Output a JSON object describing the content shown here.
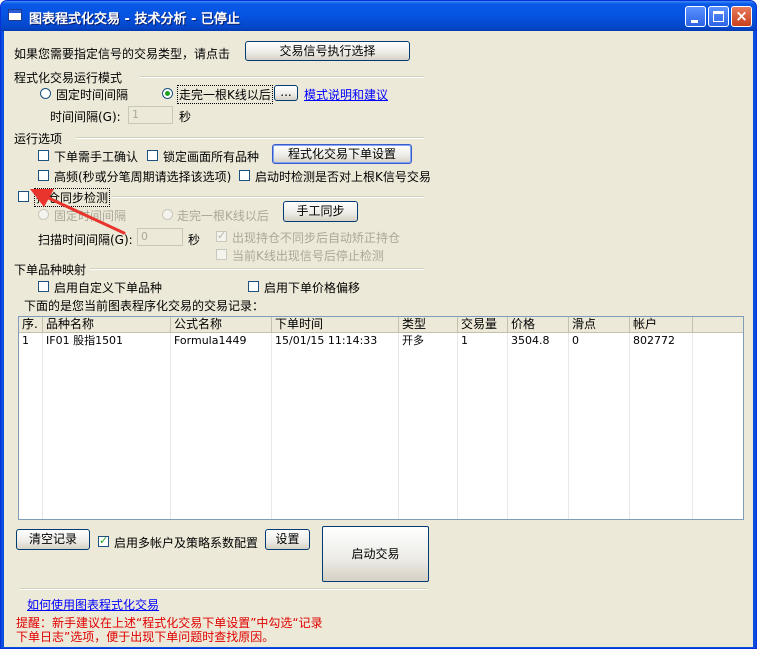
{
  "window": {
    "title": "图表程式化交易 - 技术分析 - 已停止"
  },
  "signal_type": {
    "prompt": "如果您需要指定信号的交易类型，请点击",
    "button": "交易信号执行选择"
  },
  "run_mode": {
    "section": "程式化交易运行模式",
    "option_fixed": "固定时间间隔",
    "option_bar": "走完一根K线以后",
    "more_button": "...",
    "help_link": "模式说明和建议",
    "interval_label": "时间间隔(G):",
    "interval_value": "1",
    "interval_unit": "秒"
  },
  "run_options": {
    "section": "运行选项",
    "manual_confirm": "下单需手工确认",
    "lock_all": "锁定画面所有品种",
    "order_settings_button": "程式化交易下单设置",
    "high_freq": "高频(秒或分笔周期请选择该选项)",
    "startup_check": "启动时检测是否对上根K信号交易"
  },
  "position_sync": {
    "label": "持仓同步检测",
    "option_fixed": "固定时间间隔",
    "option_bar": "走完一根K线以后",
    "manual_sync_button": "手工同步",
    "scan_label": "扫描时间间隔(G):",
    "scan_value": "0",
    "scan_unit": "秒",
    "auto_correct": "出现持仓不同步后自动矫正持仓",
    "stop_detect": "当前K线出现信号后停止检测"
  },
  "order_mapping": {
    "section": "下单品种映射",
    "custom_symbol": "启用自定义下单品种",
    "price_offset": "启用下单价格偏移"
  },
  "records": {
    "caption": "下面的是您当前图表程序化交易的交易记录：",
    "columns": [
      "序.",
      "品种名称",
      "公式名称",
      "下单时间",
      "类型",
      "交易量",
      "价格",
      "滑点",
      "帐户"
    ],
    "rows": [
      [
        "1",
        "IF01 股指1501",
        "Formula1449",
        "15/01/15 11:14:33",
        "开多",
        "1",
        "3504.8",
        "0",
        "802772"
      ]
    ]
  },
  "bottom": {
    "clear_button": "清空记录",
    "multi_account": "启用多帐户及策略系数配置",
    "settings_button": "设置",
    "start_button": "启动交易",
    "howto_link": "如何使用图表程式化交易",
    "tip_line1": "提醒：新手建议在上述“程式化交易下单设置”中勾选“记录",
    "tip_line2": "下单日志”选项，便于出现下单问题时查找原因。"
  },
  "colors": {
    "titlebar": "#0653e0",
    "tip_text": "#e00000",
    "arrow": "#e8342c"
  }
}
